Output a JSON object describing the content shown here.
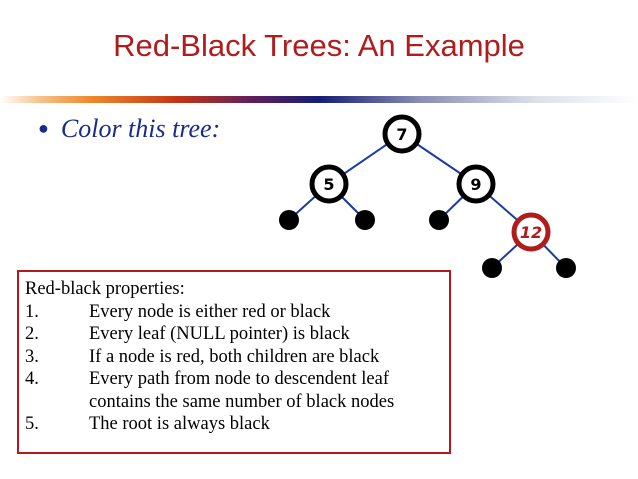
{
  "title": "Red-Black Trees: An Example",
  "bullet": "Color this tree:",
  "colors": {
    "red": "#b01c1c",
    "edge": "#1a3ca0",
    "node": "#000000",
    "accent_blue": "#1a2a8c"
  },
  "tree": {
    "nodes": [
      {
        "id": "n7",
        "label": "7",
        "color": "black"
      },
      {
        "id": "n5",
        "label": "5",
        "color": "black"
      },
      {
        "id": "n9",
        "label": "9",
        "color": "black"
      },
      {
        "id": "n12",
        "label": "12",
        "color": "red"
      }
    ],
    "leaves": [
      "leaf-5-left",
      "leaf-5-right",
      "leaf-9-left",
      "leaf-12-left",
      "leaf-12-right"
    ],
    "edges": [
      [
        "n7",
        "n5"
      ],
      [
        "n7",
        "n9"
      ],
      [
        "n5",
        "leaf-5-left"
      ],
      [
        "n5",
        "leaf-5-right"
      ],
      [
        "n9",
        "leaf-9-left"
      ],
      [
        "n9",
        "n12"
      ],
      [
        "n12",
        "leaf-12-left"
      ],
      [
        "n12",
        "leaf-12-right"
      ]
    ]
  },
  "properties": {
    "heading": "Red-black properties:",
    "items": [
      {
        "num": "1.",
        "text": "Every node is either red or black"
      },
      {
        "num": "2.",
        "text": "Every leaf (NULL pointer) is black"
      },
      {
        "num": "3.",
        "text": "If a node is red, both children are black"
      },
      {
        "num": "4.",
        "text": "Every path from node to descendent leaf"
      },
      {
        "num": "",
        "text": "contains the same number of black nodes"
      },
      {
        "num": "5.",
        "text": "The root is always black"
      }
    ]
  }
}
